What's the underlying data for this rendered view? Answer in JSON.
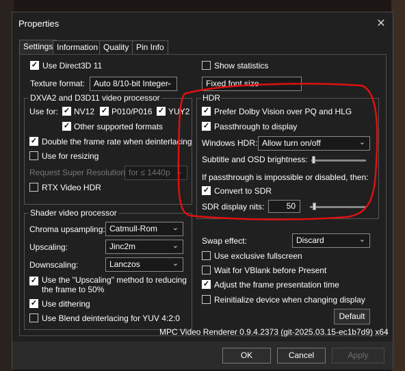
{
  "window": {
    "title": "Properties",
    "close_symbol": "✕"
  },
  "tabs": [
    "Settings",
    "Information",
    "Quality",
    "Pin Info"
  ],
  "left": {
    "use_d3d11": {
      "label": "Use Direct3D 11",
      "checked": true
    },
    "texture_format": {
      "label": "Texture format:",
      "value": "Auto 8/10-bit Integer"
    },
    "dxva": {
      "legend": "DXVA2 and D3D11 video processor",
      "use_for": "Use for:",
      "nv12": {
        "label": "NV12",
        "checked": true
      },
      "p010": {
        "label": "P010/P016",
        "checked": true
      },
      "yuy2": {
        "label": "YUY2",
        "checked": true
      },
      "other": {
        "label": "Other supported formats",
        "checked": true
      },
      "double_rate": {
        "label": "Double the frame rate when deinterlacing",
        "checked": true
      },
      "resizing": {
        "label": "Use for resizing",
        "checked": false
      },
      "super_res": {
        "label": "Request Super Resolution:",
        "value": "for ≤ 1440p"
      },
      "rtx_hdr": {
        "label": "RTX Video HDR",
        "checked": false
      }
    },
    "shader": {
      "legend": "Shader video processor",
      "chroma": {
        "label": "Chroma upsampling:",
        "value": "Catmull-Rom"
      },
      "upscaling": {
        "label": "Upscaling:",
        "value": "Jinc2m"
      },
      "downscaling": {
        "label": "Downscaling:",
        "value": "Lanczos"
      },
      "upscaling_method": {
        "line1": "Use the \"Upscaling\" method to reducing",
        "line2": "the frame to 50%",
        "checked": true
      },
      "dithering": {
        "label": "Use dithering",
        "checked": true
      },
      "blend": {
        "label": "Use Blend deinterlacing for YUV 4:2:0",
        "checked": false
      }
    }
  },
  "right": {
    "show_stats": {
      "label": "Show statistics",
      "checked": false
    },
    "font": {
      "value": "Fixed font size"
    },
    "hdr": {
      "legend": "HDR",
      "dolby": {
        "label": "Prefer Dolby Vision over PQ and HLG",
        "checked": true
      },
      "passthrough": {
        "label": "Passthrough to display",
        "checked": true
      },
      "windows_hdr": {
        "label": "Windows HDR:",
        "value": "Allow turn on/off"
      },
      "osd_brightness": {
        "label": "Subtitle and OSD brightness:"
      },
      "if_passthrough": "If passthrough is impossible or disabled, then:",
      "convert": {
        "label": "Convert to SDR",
        "checked": true
      },
      "sdr_nits": {
        "label": "SDR display nits:",
        "value": "50"
      }
    },
    "swap": {
      "label": "Swap effect:",
      "value": "Discard"
    },
    "exclusive": {
      "label": "Use exclusive fullscreen",
      "checked": false
    },
    "vblank": {
      "label": "Wait for VBlank before Present",
      "checked": false
    },
    "adjust": {
      "label": "Adjust the frame presentation time",
      "checked": true
    },
    "reinit": {
      "label": "Reinitialize device when changing display",
      "checked": false
    },
    "default_btn": "Default"
  },
  "version": "MPC Video Renderer 0.9.4.2373 (git-2025.03.15-ec1b7d9) x64",
  "buttons": {
    "ok": "OK",
    "cancel": "Cancel",
    "apply": "Apply"
  },
  "symbols": {
    "check": "✓",
    "arrow": "⌄"
  },
  "colors": {
    "annotation": "#e01010",
    "window_bg": "#202020"
  }
}
